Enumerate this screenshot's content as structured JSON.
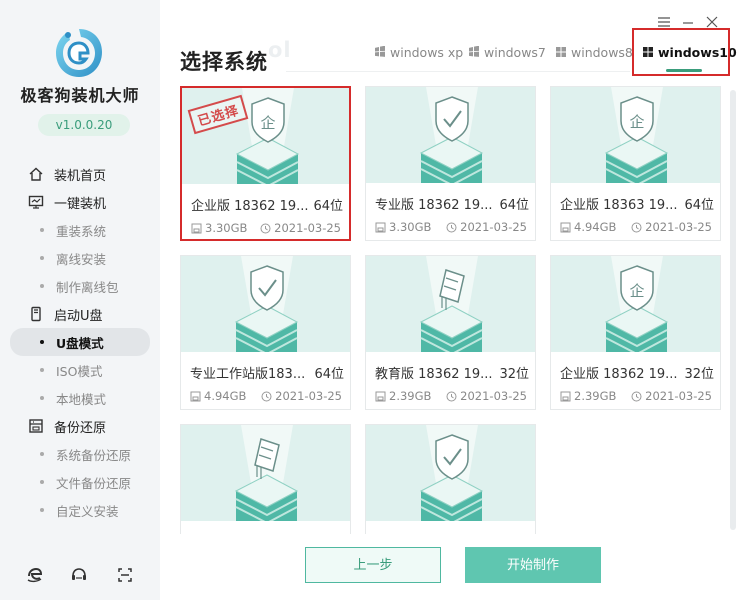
{
  "app": {
    "brand": "极客狗装机大师",
    "version": "v1.0.0.20",
    "colors": {
      "accent": "#3a9d7c",
      "selected_border": "#d52b2b",
      "thumb_bg": "#dff1ee"
    }
  },
  "sidebar": {
    "groups": [
      {
        "label": "装机首页",
        "icon": "home-icon"
      },
      {
        "label": "一键装机",
        "icon": "monitor-icon",
        "items": [
          "重装系统",
          "离线安装",
          "制作离线包"
        ]
      },
      {
        "label": "启动U盘",
        "icon": "usb-icon",
        "items": [
          "U盘模式",
          "ISO模式",
          "本地模式"
        ]
      },
      {
        "label": "备份还原",
        "icon": "backup-icon",
        "items": [
          "系统备份还原",
          "文件备份还原",
          "自定义安装"
        ]
      }
    ],
    "active_item": "U盘模式",
    "bottom_icons": [
      "browser-icon",
      "chat-icon",
      "scan-icon"
    ]
  },
  "header": {
    "title": "选择系统",
    "ghost_text": "ol",
    "tabs": [
      "windows xp",
      "windows7",
      "windows8",
      "windows10"
    ],
    "active_tab": "windows10"
  },
  "stamp": "已选择",
  "cards": [
    {
      "name": "企业版 18362 19...",
      "bits": "64位",
      "size": "3.30GB",
      "date": "2021-03-25",
      "selected": true,
      "icon": "shield-enterprise-icon"
    },
    {
      "name": "专业版 18362 19...",
      "bits": "64位",
      "size": "3.30GB",
      "date": "2021-03-25",
      "selected": false,
      "icon": "shield-check-icon"
    },
    {
      "name": "企业版 18363 19...",
      "bits": "64位",
      "size": "4.94GB",
      "date": "2021-03-25",
      "selected": false,
      "icon": "shield-enterprise-icon"
    },
    {
      "name": "专业工作站版183...",
      "bits": "64位",
      "size": "4.94GB",
      "date": "2021-03-25",
      "selected": false,
      "icon": "shield-check-icon"
    },
    {
      "name": "教育版 18362 19...",
      "bits": "32位",
      "size": "2.39GB",
      "date": "2021-03-25",
      "selected": false,
      "icon": "graduation-icon"
    },
    {
      "name": "企业版 18362 19...",
      "bits": "32位",
      "size": "2.39GB",
      "date": "2021-03-25",
      "selected": false,
      "icon": "shield-enterprise-icon"
    },
    {
      "name": "",
      "bits": "",
      "size": "",
      "date": "",
      "selected": false,
      "icon": "graduation-icon"
    },
    {
      "name": "",
      "bits": "",
      "size": "",
      "date": "",
      "selected": false,
      "icon": "shield-check-icon"
    }
  ],
  "footer": {
    "prev_label": "上一步",
    "start_label": "开始制作"
  }
}
